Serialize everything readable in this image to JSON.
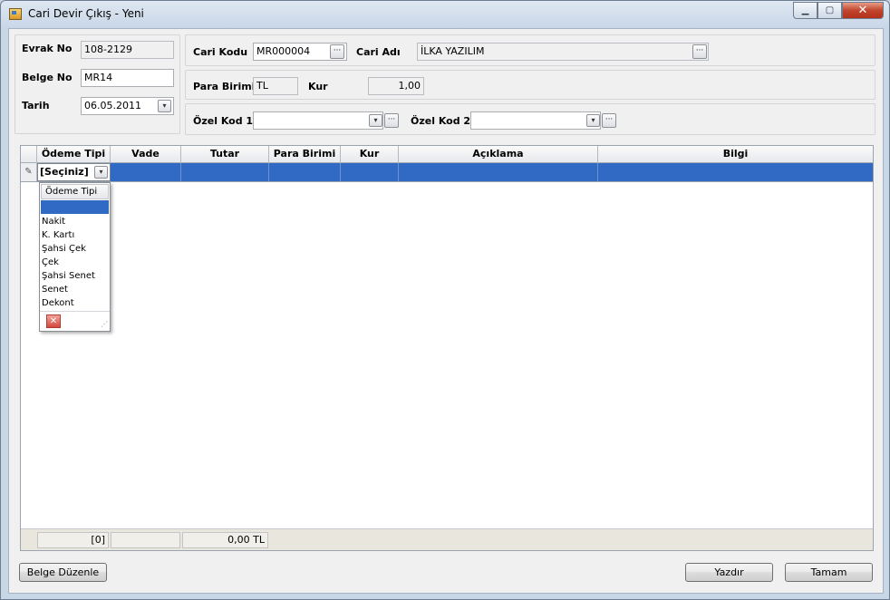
{
  "window": {
    "title": "Cari Devir Çıkış - Yeni",
    "controls": {
      "minimize": "▁",
      "maximize": "▢",
      "close": "✕"
    }
  },
  "header": {
    "evrak_no": {
      "label": "Evrak No",
      "value": "108-2129"
    },
    "belge_no": {
      "label": "Belge No",
      "value": "MR14"
    },
    "tarih": {
      "label": "Tarih",
      "value": "06.05.2011"
    },
    "cari_kodu": {
      "label": "Cari Kodu",
      "value": "MR000004"
    },
    "cari_adi": {
      "label": "Cari Adı",
      "value": "İLKA YAZILIM"
    },
    "para_birimi": {
      "label": "Para Birimi",
      "value": "TL"
    },
    "kur": {
      "label": "Kur",
      "value": "1,00"
    },
    "ozel_kod_1": {
      "label": "Özel Kod 1",
      "value": ""
    },
    "ozel_kod_2": {
      "label": "Özel Kod 2",
      "value": ""
    }
  },
  "grid": {
    "columns": [
      "Ödeme Tipi",
      "Vade",
      "Tutar",
      "Para Birimi",
      "Kur",
      "Açıklama",
      "Bilgi"
    ],
    "editing_value": "[Seçiniz]",
    "dropdown": {
      "header": "Ödeme Tipi",
      "items": [
        "Nakit",
        "K. Kartı",
        "Şahsi Çek",
        "Çek",
        "Şahsi Senet",
        "Senet",
        "Dekont"
      ]
    },
    "footer": {
      "count": "[0]",
      "blank": "",
      "total": "0,00 TL"
    }
  },
  "buttons": {
    "belge_duzenle": "Belge Düzenle",
    "yazdir": "Yazdır",
    "tamam": "Tamam"
  },
  "icons": {
    "dropdown_arrow": "▾",
    "ellipsis": "···",
    "pencil": "✎",
    "close_x": "✕",
    "grip": "⋰"
  }
}
